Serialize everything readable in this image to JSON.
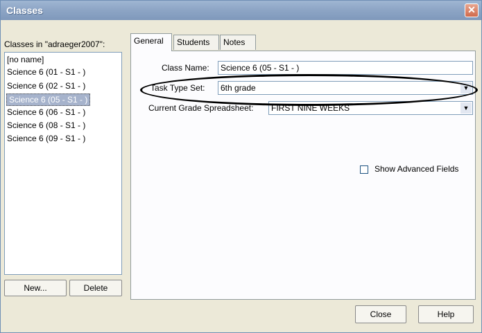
{
  "window": {
    "title": "Classes"
  },
  "left_panel": {
    "header": "Classes in \"adraeger2007\":",
    "items": [
      {
        "label": "[no name]",
        "selected": false
      },
      {
        "label": "Science 6 (01 - S1 - )",
        "selected": false
      },
      {
        "label": "Science 6 (02 - S1 - )",
        "selected": false
      },
      {
        "label": "Science 6 (05 - S1 - )",
        "selected": true
      },
      {
        "label": "Science 6 (06 - S1 - )",
        "selected": false
      },
      {
        "label": "Science 6 (08 - S1 - )",
        "selected": false
      },
      {
        "label": "Science 6 (09 - S1 - )",
        "selected": false
      }
    ],
    "new_button": "New...",
    "delete_button": "Delete"
  },
  "tabs": [
    {
      "label": "General",
      "active": true
    },
    {
      "label": "Students",
      "active": false
    },
    {
      "label": "Notes",
      "active": false
    }
  ],
  "general": {
    "class_name_label": "Class Name:",
    "class_name_value": "Science 6 (05 - S1 - )",
    "task_type_label": "Task Type Set:",
    "task_type_value": "6th grade",
    "grade_spreadsheet_label": "Current Grade Spreadsheet:",
    "grade_spreadsheet_value": "FIRST NINE WEEKS",
    "show_advanced_label": "Show Advanced Fields",
    "show_advanced_checked": false
  },
  "footer": {
    "close_button": "Close",
    "help_button": "Help"
  }
}
